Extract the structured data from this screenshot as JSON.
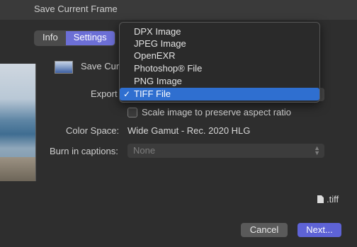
{
  "window": {
    "title": "Save Current Frame"
  },
  "tabs": [
    {
      "label": "Info",
      "active": false
    },
    {
      "label": "Settings",
      "active": true
    }
  ],
  "form": {
    "save_label": "Save Current Frame",
    "export_label": "Export",
    "scale_checkbox": {
      "label": "Scale image to preserve aspect ratio",
      "checked": false
    },
    "color_space": {
      "label": "Color Space:",
      "value": "Wide Gamut - Rec. 2020 HLG"
    },
    "burn_captions": {
      "label": "Burn in captions:",
      "value": "None"
    }
  },
  "export_menu": {
    "items": [
      {
        "label": "DPX Image",
        "selected": false
      },
      {
        "label": "JPEG Image",
        "selected": false
      },
      {
        "label": "OpenEXR",
        "selected": false
      },
      {
        "label": "Photoshop® File",
        "selected": false
      },
      {
        "label": "PNG Image",
        "selected": false
      },
      {
        "label": "TIFF File",
        "selected": true
      }
    ],
    "check_mark": "✓"
  },
  "file_extension": ".tiff",
  "buttons": {
    "cancel": "Cancel",
    "next": "Next..."
  },
  "colors": {
    "accent": "#6c6fd6",
    "menu_highlight": "#2f6fd0",
    "next_button": "#5e63d6"
  }
}
